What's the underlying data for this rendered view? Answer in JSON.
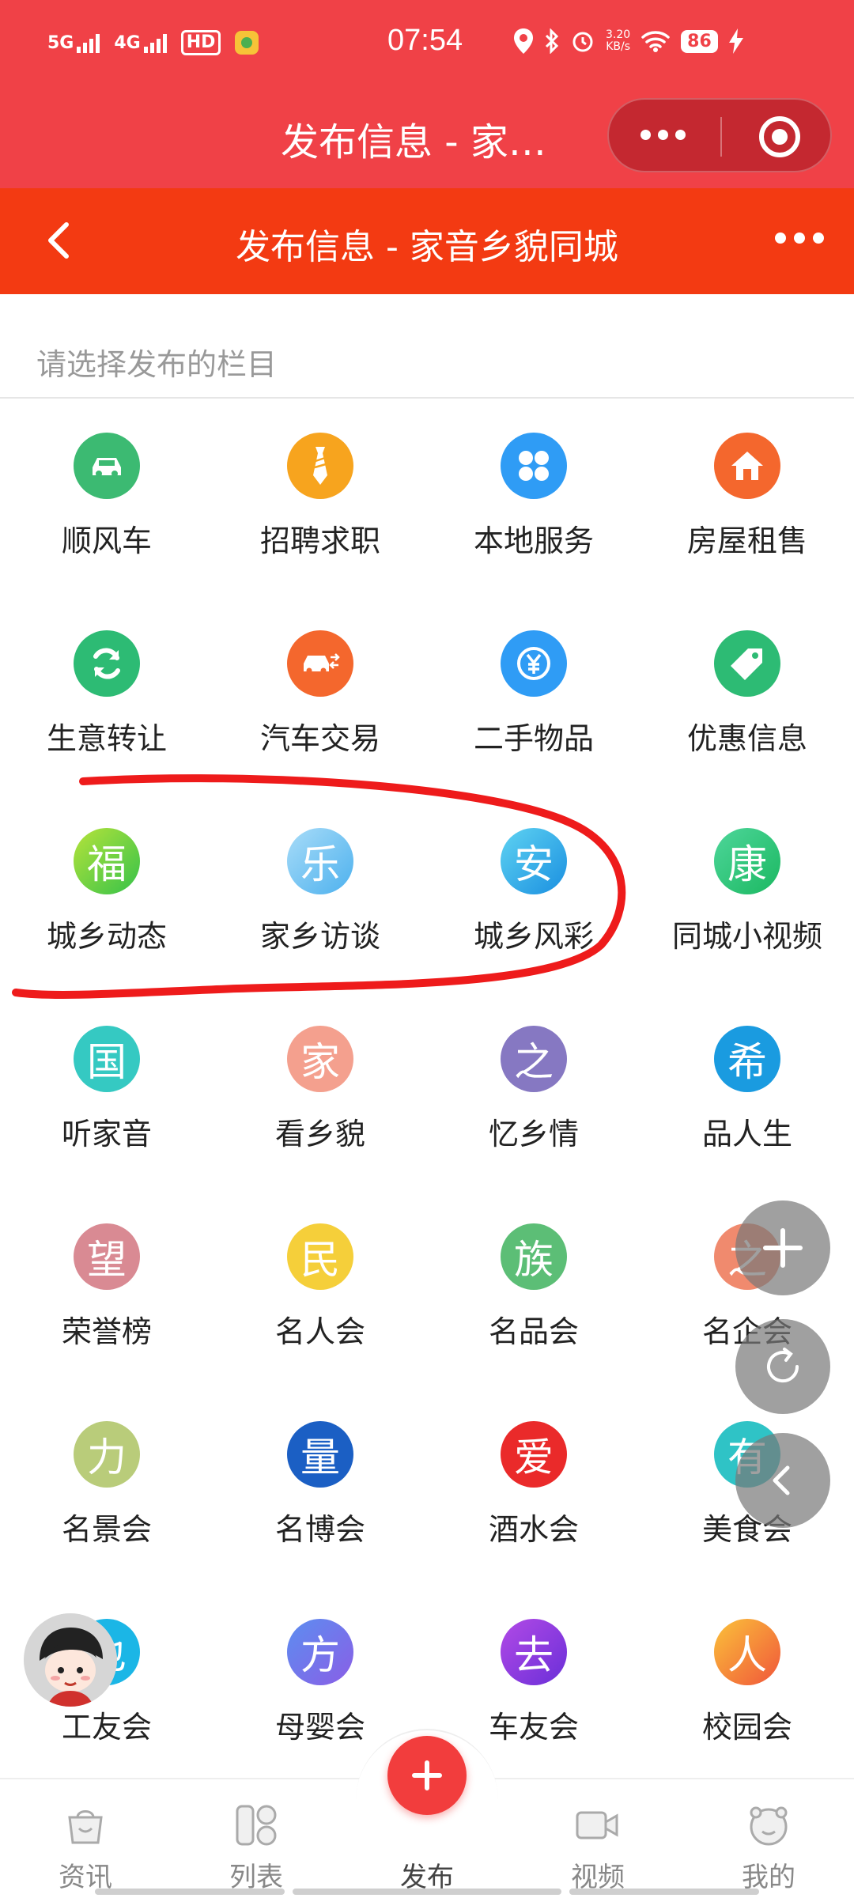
{
  "status_bar": {
    "net1": "5G",
    "net2": "4G",
    "hd": "HD",
    "time": "07:54",
    "speed_value": "3.20",
    "speed_unit": "KB/s",
    "battery": "86"
  },
  "miniapp_header": {
    "title": "发布信息 - 家…"
  },
  "navbar": {
    "title": "发布信息 - 家音乡貌同城"
  },
  "prompt": "请选择发布的栏目",
  "categories": [
    {
      "label": "顺风车",
      "icon": "car-icon",
      "color": "#3cba72"
    },
    {
      "label": "招聘求职",
      "icon": "tie-icon",
      "color": "#f7a41e"
    },
    {
      "label": "本地服务",
      "icon": "grid-icon",
      "color": "#2f9cf5"
    },
    {
      "label": "房屋租售",
      "icon": "house-icon",
      "color": "#f4672d"
    },
    {
      "label": "生意转让",
      "icon": "refresh-icon",
      "color": "#2dbb74"
    },
    {
      "label": "汽车交易",
      "icon": "car-exchange-icon",
      "color": "#f4672d"
    },
    {
      "label": "二手物品",
      "icon": "yen-icon",
      "color": "#2f9cf5"
    },
    {
      "label": "优惠信息",
      "icon": "tag-icon",
      "color": "#2dbb74"
    },
    {
      "label": "城乡动态",
      "glyph": "福",
      "color": "#5fcf2e"
    },
    {
      "label": "家乡访谈",
      "glyph": "乐",
      "color": "#6cc3f2"
    },
    {
      "label": "城乡风彩",
      "glyph": "安",
      "color": "#1fa8e8"
    },
    {
      "label": "同城小视频",
      "glyph": "康",
      "color": "#2ec97d"
    },
    {
      "label": "听家音",
      "glyph": "国",
      "color": "#35c9c2"
    },
    {
      "label": "看乡貌",
      "glyph": "家",
      "color": "#f4a08e"
    },
    {
      "label": "忆乡情",
      "glyph": "之",
      "color": "#8678c2"
    },
    {
      "label": "品人生",
      "glyph": "希",
      "color": "#1a9be0"
    },
    {
      "label": "荣誉榜",
      "glyph": "望",
      "color": "#d98a93"
    },
    {
      "label": "名人会",
      "glyph": "民",
      "color": "#f5cf3a"
    },
    {
      "label": "名品会",
      "glyph": "族",
      "color": "#5cbe76"
    },
    {
      "label": "名企会",
      "glyph": "之",
      "color": "#f08a6e"
    },
    {
      "label": "名景会",
      "glyph": "力",
      "color": "#b9cc7a"
    },
    {
      "label": "名博会",
      "glyph": "量",
      "color": "#1b5fc4"
    },
    {
      "label": "酒水会",
      "glyph": "爱",
      "color": "#ea2a2a"
    },
    {
      "label": "美食会",
      "glyph": "有",
      "color": "#2fc3c6"
    },
    {
      "label": "工友会",
      "glyph": "也",
      "color": "#1bb6e6"
    },
    {
      "label": "母婴会",
      "glyph": "方",
      "color": "#7a68e6"
    },
    {
      "label": "车友会",
      "glyph": "去",
      "color": "#9a3fe0"
    },
    {
      "label": "校园会",
      "glyph": "人",
      "color": "#f49a22"
    }
  ],
  "floating": {
    "add": "add-icon",
    "refresh": "refresh-icon",
    "back": "chevron-left-icon"
  },
  "tabbar": {
    "tabs": [
      {
        "label": "资讯"
      },
      {
        "label": "列表"
      },
      {
        "label": "发布"
      },
      {
        "label": "视频"
      },
      {
        "label": "我的"
      }
    ]
  },
  "colors": {
    "header_red": "#f04147",
    "nav_red": "#f33a12",
    "annotation": "#ee1b1b"
  }
}
